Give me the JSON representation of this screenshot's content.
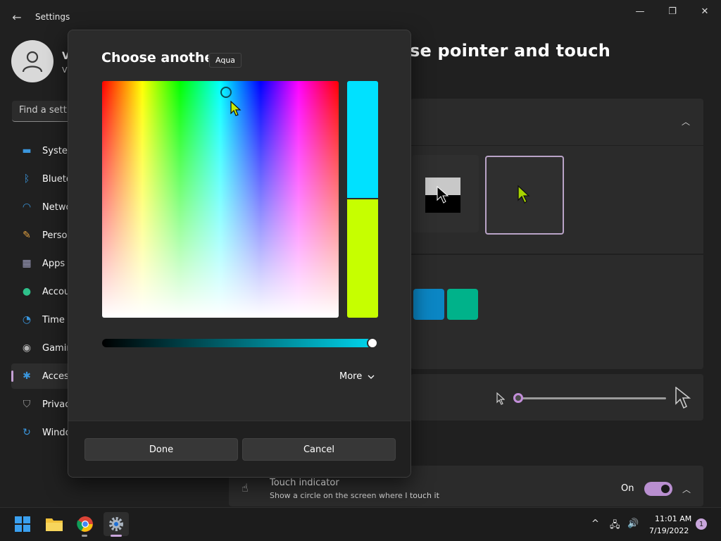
{
  "window": {
    "back_icon": "arrow-left-icon",
    "title": "Settings",
    "controls": {
      "minimize": "—",
      "maximize": "❐",
      "close": "✕"
    }
  },
  "user": {
    "name": "V",
    "sub": "V",
    "avatar_icon": "person-icon"
  },
  "search": {
    "placeholder": "Find a setti"
  },
  "sidebar": {
    "items": [
      {
        "label": "Systen",
        "icon": "monitor-icon",
        "color": "#3a96dd"
      },
      {
        "label": "Blueto",
        "icon": "bluetooth-icon",
        "color": "#3a96dd"
      },
      {
        "label": "Netwo",
        "icon": "wifi-icon",
        "color": "#3a96dd"
      },
      {
        "label": "Perso",
        "icon": "brush-icon",
        "color": "#e0a040"
      },
      {
        "label": "Apps",
        "icon": "apps-icon",
        "color": "#a0a0c0"
      },
      {
        "label": "Accou",
        "icon": "account-icon",
        "color": "#2ec08a"
      },
      {
        "label": "Time",
        "icon": "clock-icon",
        "color": "#3a96dd"
      },
      {
        "label": "Gamin",
        "icon": "gamepad-icon",
        "color": "#b0b0b0"
      },
      {
        "label": "Acces",
        "icon": "accessibility-icon",
        "color": "#3a96dd",
        "active": true
      },
      {
        "label": "Privac",
        "icon": "shield-icon",
        "color": "#a0a0a0"
      },
      {
        "label": "Windo",
        "icon": "update-icon",
        "color": "#3a96dd"
      }
    ]
  },
  "main": {
    "page_title": "se pointer and touch",
    "touch": {
      "title": "Touch indicator",
      "description": "Show a circle on the screen where I touch it",
      "state_label": "On",
      "icon": "touch-icon"
    },
    "swatch_colors": [
      "#0b86c4",
      "#00b28a"
    ]
  },
  "dialog": {
    "title": "Choose another c",
    "tooltip": "Aqua",
    "new_color": "#00e1ff",
    "old_color": "#c6ff00",
    "value_level": 0.98,
    "more_label": "More",
    "done_label": "Done",
    "cancel_label": "Cancel"
  },
  "taskbar": {
    "icons": [
      "windows-start-icon",
      "file-explorer-icon",
      "chrome-icon",
      "settings-icon"
    ],
    "time": "11:01 AM",
    "date": "7/19/2022",
    "notification_count": "1"
  }
}
